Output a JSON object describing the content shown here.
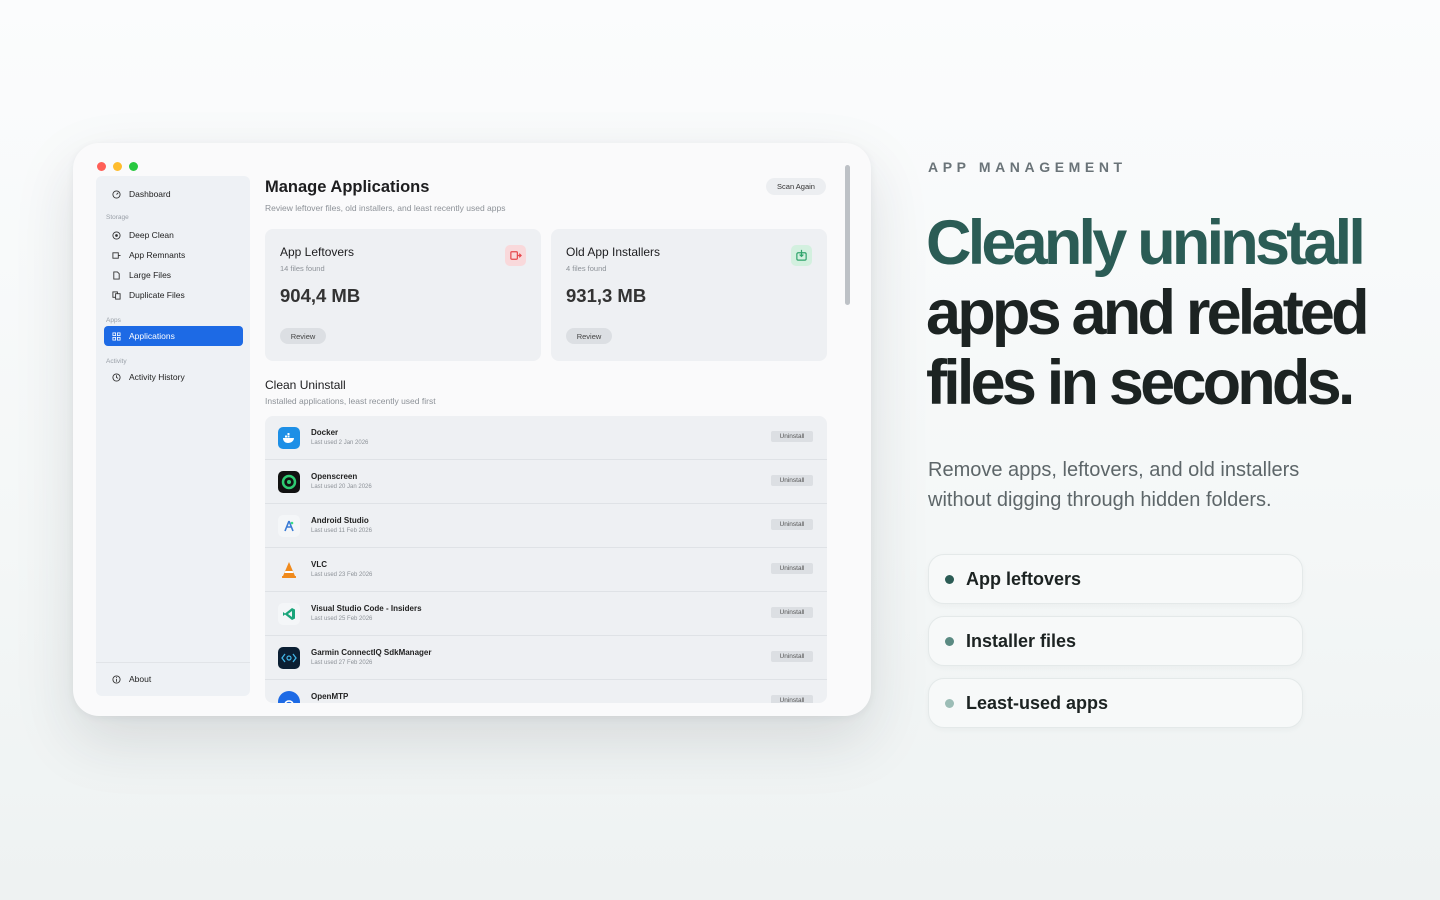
{
  "window": {
    "sidebar": {
      "items": [
        {
          "label": "Dashboard",
          "icon": "dashboard-icon"
        },
        {
          "label": "Deep Clean",
          "icon": "deep-clean-icon"
        },
        {
          "label": "App Remnants",
          "icon": "remnants-icon"
        },
        {
          "label": "Large Files",
          "icon": "large-files-icon"
        },
        {
          "label": "Duplicate Files",
          "icon": "duplicate-icon"
        },
        {
          "label": "Applications",
          "icon": "applications-icon",
          "active": true
        },
        {
          "label": "Activity History",
          "icon": "history-icon"
        }
      ],
      "sections": {
        "storage": "Storage",
        "apps": "Apps",
        "activity": "Activity"
      },
      "about": "About"
    },
    "header": {
      "title": "Manage Applications",
      "subtitle": "Review leftover files, old installers, and least recently used apps",
      "scan_again": "Scan Again"
    },
    "cards": [
      {
        "title": "App Leftovers",
        "count": "14 files found",
        "size": "904,4 MB",
        "review": "Review",
        "icon": "leftovers-icon",
        "color": "#e5484d"
      },
      {
        "title": "Old App Installers",
        "count": "4 files found",
        "size": "931,3 MB",
        "review": "Review",
        "icon": "installer-icon",
        "color": "#30a46c"
      }
    ],
    "uninstall_section": {
      "title": "Clean Uninstall",
      "subtitle": "Installed applications, least recently used first"
    },
    "apps": [
      {
        "name": "Docker",
        "last_used": "Last used 2 Jan 2026",
        "action": "Uninstall",
        "icon": "docker-icon"
      },
      {
        "name": "Openscreen",
        "last_used": "Last used 20 Jan 2026",
        "action": "Uninstall",
        "icon": "openscreen-icon"
      },
      {
        "name": "Android Studio",
        "last_used": "Last used 11 Feb 2026",
        "action": "Uninstall",
        "icon": "android-studio-icon"
      },
      {
        "name": "VLC",
        "last_used": "Last used 23 Feb 2026",
        "action": "Uninstall",
        "icon": "vlc-icon"
      },
      {
        "name": "Visual Studio Code - Insiders",
        "last_used": "Last used 25 Feb 2026",
        "action": "Uninstall",
        "icon": "vscode-insiders-icon"
      },
      {
        "name": "Garmin ConnectIQ SdkManager",
        "last_used": "Last used 27 Feb 2026",
        "action": "Uninstall",
        "icon": "garmin-icon"
      },
      {
        "name": "OpenMTP",
        "last_used": "",
        "action": "Uninstall",
        "icon": "openmtp-icon"
      }
    ]
  },
  "marketing": {
    "eyebrow": "APP MANAGEMENT",
    "headline": {
      "line1": "Cleanly uninstall",
      "line2": "apps and related",
      "line3": "files in seconds."
    },
    "body": "Remove apps, leftovers, and old installers without digging through hidden folders.",
    "features": [
      {
        "label": "App leftovers",
        "dot_color": "#2b5c55"
      },
      {
        "label": "Installer files",
        "dot_color": "#5a8a82"
      },
      {
        "label": "Least-used apps",
        "dot_color": "#9cbdb6"
      }
    ]
  },
  "colors": {
    "accent": "#1d6ae5",
    "brand_green": "#2b5c55"
  }
}
